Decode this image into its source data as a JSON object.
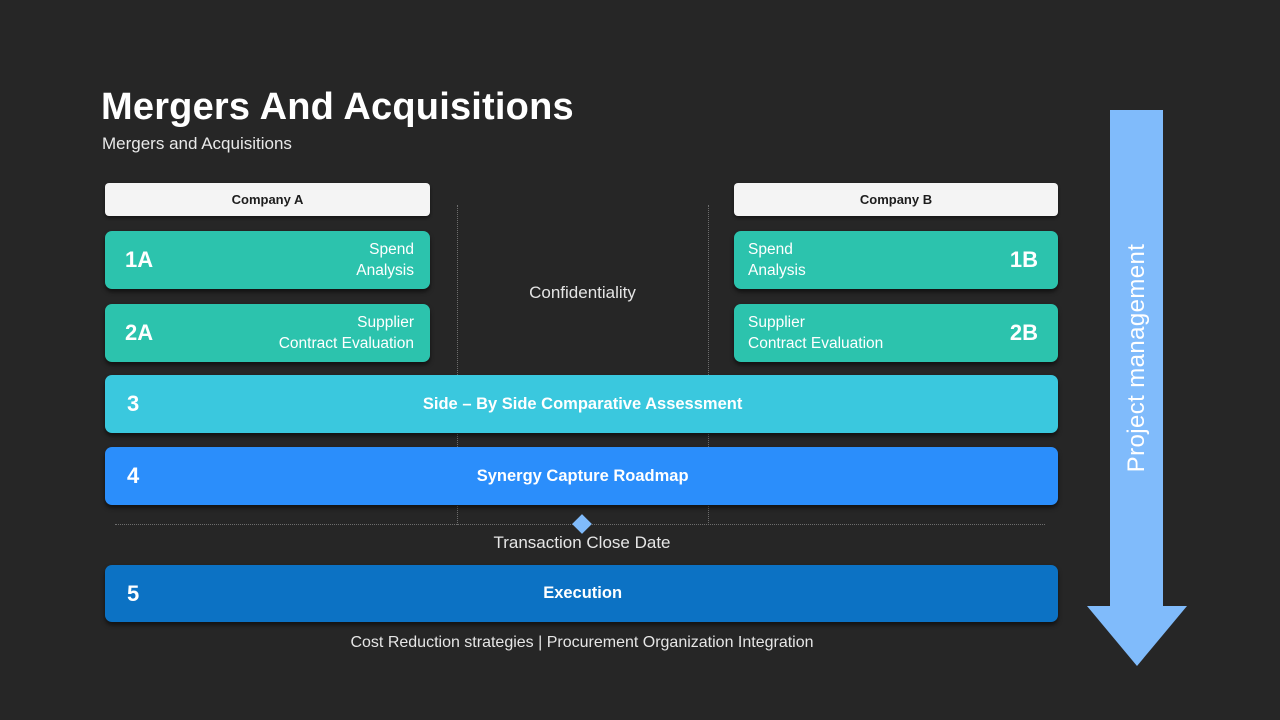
{
  "slide": {
    "title": "Mergers And Acquisitions",
    "subtitle": "Mergers and Acquisitions",
    "background_color": "#262626"
  },
  "columns": {
    "left_header": "Company A",
    "right_header": "Company B",
    "middle_label": "Confidentiality"
  },
  "left_items": [
    {
      "number": "1A",
      "label": "Spend\nAnalysis",
      "color": "#2cc3ad"
    },
    {
      "number": "2A",
      "label": "Supplier\nContract Evaluation",
      "color": "#2cc3ad"
    }
  ],
  "right_items": [
    {
      "number": "1B",
      "label": "Spend\nAnalysis",
      "color": "#2cc3ad"
    },
    {
      "number": "2B",
      "label": "Supplier\nContract Evaluation",
      "color": "#2cc3ad"
    }
  ],
  "full_rows": [
    {
      "number": "3",
      "label": "Side – By Side Comparative  Assessment",
      "color": "#3ac8de"
    },
    {
      "number": "4",
      "label": "Synergy Capture  Roadmap",
      "color": "#2b8efb"
    },
    {
      "number": "5",
      "label": "Execution",
      "color": "#0c72c4"
    }
  ],
  "milestone": {
    "label": "Transaction Close Date",
    "marker_icon": "diamond-icon",
    "marker_color": "#80bbfb"
  },
  "footer": {
    "note": "Cost Reduction strategies | Procurement Organization Integration"
  },
  "arrow": {
    "label": "Project management",
    "icon": "down-arrow-icon",
    "color": "#80bbfb"
  }
}
